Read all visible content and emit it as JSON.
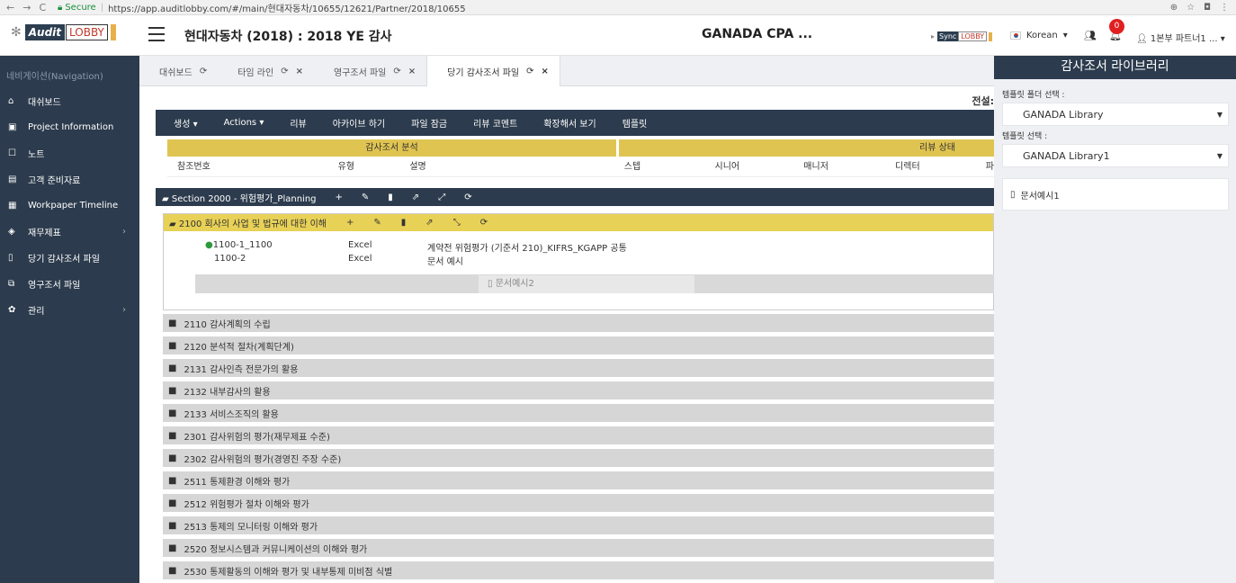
{
  "browser": {
    "secure": "Secure",
    "url": "https://app.auditlobby.com/#/main/현대자동차/10655/12621/Partner/2018/10655"
  },
  "header": {
    "logo_audit": "Audit",
    "logo_lobby": "LOBBY",
    "title": "현대자동차 (2018) : 2018 YE 감사",
    "company": "GANADA CPA ...",
    "sync_label": "Sync",
    "sync_lobby": "LOBBY",
    "language": "Korean",
    "notification_count": "0",
    "user": "1본부 파트너1 ..."
  },
  "sidebar": {
    "title": "네비게이션(Navigation)",
    "items": [
      {
        "label": "대쉬보드",
        "icon": "home-icon"
      },
      {
        "label": "Project Information",
        "icon": "info-icon"
      },
      {
        "label": "노트",
        "icon": "note-icon"
      },
      {
        "label": "고객 준비자료",
        "icon": "folder-icon"
      },
      {
        "label": "Workpaper Timeline",
        "icon": "calendar-icon"
      },
      {
        "label": "재무제표",
        "icon": "chart-icon",
        "has_arrow": true
      },
      {
        "label": "당기 감사조서 파일",
        "icon": "file-icon"
      },
      {
        "label": "영구조서 파일",
        "icon": "files-icon"
      },
      {
        "label": "관리",
        "icon": "gear-icon",
        "has_arrow": true
      }
    ]
  },
  "tabs": [
    {
      "label": "대쉬보드"
    },
    {
      "label": "타임 라인"
    },
    {
      "label": "영구조서 파일"
    },
    {
      "label": "당기 감사조서 파일",
      "active": true
    }
  ],
  "content": {
    "jeonseol": "전설:",
    "menu": [
      "생성 ▾",
      "Actions ▾",
      "리뷰",
      "아카이브 하기",
      "파일 잠금",
      "리뷰 코멘트",
      "확장해서 보기",
      "템플릿"
    ],
    "group_headers": {
      "analysis": "감사조서 분석",
      "review": "리뷰 상태"
    },
    "columns": [
      "참조번호",
      "유형",
      "설명",
      "스텝",
      "시니어",
      "매니저",
      "디렉터",
      "파"
    ],
    "section": "Section 2000 - 위험평가_Planning",
    "subsection": "2100 회사의 사업 및 법규에 대한 이해",
    "files": [
      {
        "ref": "1100-1_1100",
        "type": "Excel",
        "desc": "계약전 위험평가 (기준서 210)_KIFRS_KGAPP 공통"
      },
      {
        "ref": "1100-2",
        "type": "Excel",
        "desc": "문서 예시"
      }
    ],
    "drag_ghost": "문서예시2",
    "folders": [
      "2110 감사계획의 수립",
      "2120 분석적 절차(계획단계)",
      "2131 감사인측 전문가의 활용",
      "2132 내부감사의 활용",
      "2133 서비스조직의 활용",
      "2301 감사위험의 평가(재무제표 수준)",
      "2302 감사위험의 평가(경영진 주장 수준)",
      "2511 통제환경 이해와 평가",
      "2512 위험평가 절차 이해와 평가",
      "2513 통제의 모니터링 이해와 평가",
      "2520 정보시스템과 커뮤니케이션의 이해와 평가",
      "2530 통제활동의 이해와 평가 및 내부통제 미비점 식별"
    ]
  },
  "library": {
    "title": "감사조서 라이브러리",
    "folder_label": "템플릿 폴더 선택 :",
    "folder_value": "GANADA Library",
    "template_label": "템플릿 선택 :",
    "template_value": "GANADA Library1",
    "document": "문서예시1"
  }
}
